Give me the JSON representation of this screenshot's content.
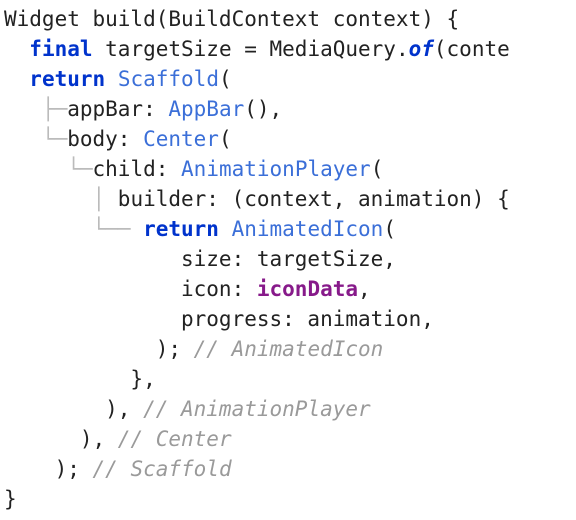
{
  "code": {
    "l1": {
      "t1": "Widget build(BuildContext context) {"
    },
    "l2": {
      "t1": "  ",
      "kw": "final",
      "t2": " targetSize = MediaQuery.",
      "of": "of",
      "t3": "(conte"
    },
    "l3": {
      "t1": "  ",
      "kw": "return",
      "t2": " ",
      "type": "Scaffold",
      "t3": "("
    },
    "l4": {
      "g": "   ├─",
      "t1": "appBar: ",
      "type": "AppBar",
      "t2": "(),"
    },
    "l5": {
      "g": "   └─",
      "t1": "body: ",
      "type": "Center",
      "t2": "("
    },
    "l6": {
      "g": "     └─",
      "t1": "child: ",
      "type": "AnimationPlayer",
      "t2": "("
    },
    "l7": {
      "g": "       │ ",
      "t1": "builder: (context, animation) {"
    },
    "l8": {
      "g": "       └── ",
      "kw": "return",
      "t1": " ",
      "type": "AnimatedIcon",
      "t2": "("
    },
    "l9": {
      "t1": "              size: targetSize,"
    },
    "l10": {
      "t1": "              icon: ",
      "prop": "iconData",
      "t2": ","
    },
    "l11": {
      "t1": "              progress: animation,"
    },
    "l12": {
      "t1": "            ); ",
      "cmt": "// AnimatedIcon"
    },
    "l13": {
      "t1": "          },"
    },
    "l14": {
      "t1": "        ), ",
      "cmt": "// AnimationPlayer"
    },
    "l15": {
      "t1": "      ), ",
      "cmt": "// Center"
    },
    "l16": {
      "t1": "    ); ",
      "cmt": "// Scaffold"
    },
    "l17": {
      "t1": "}"
    }
  }
}
